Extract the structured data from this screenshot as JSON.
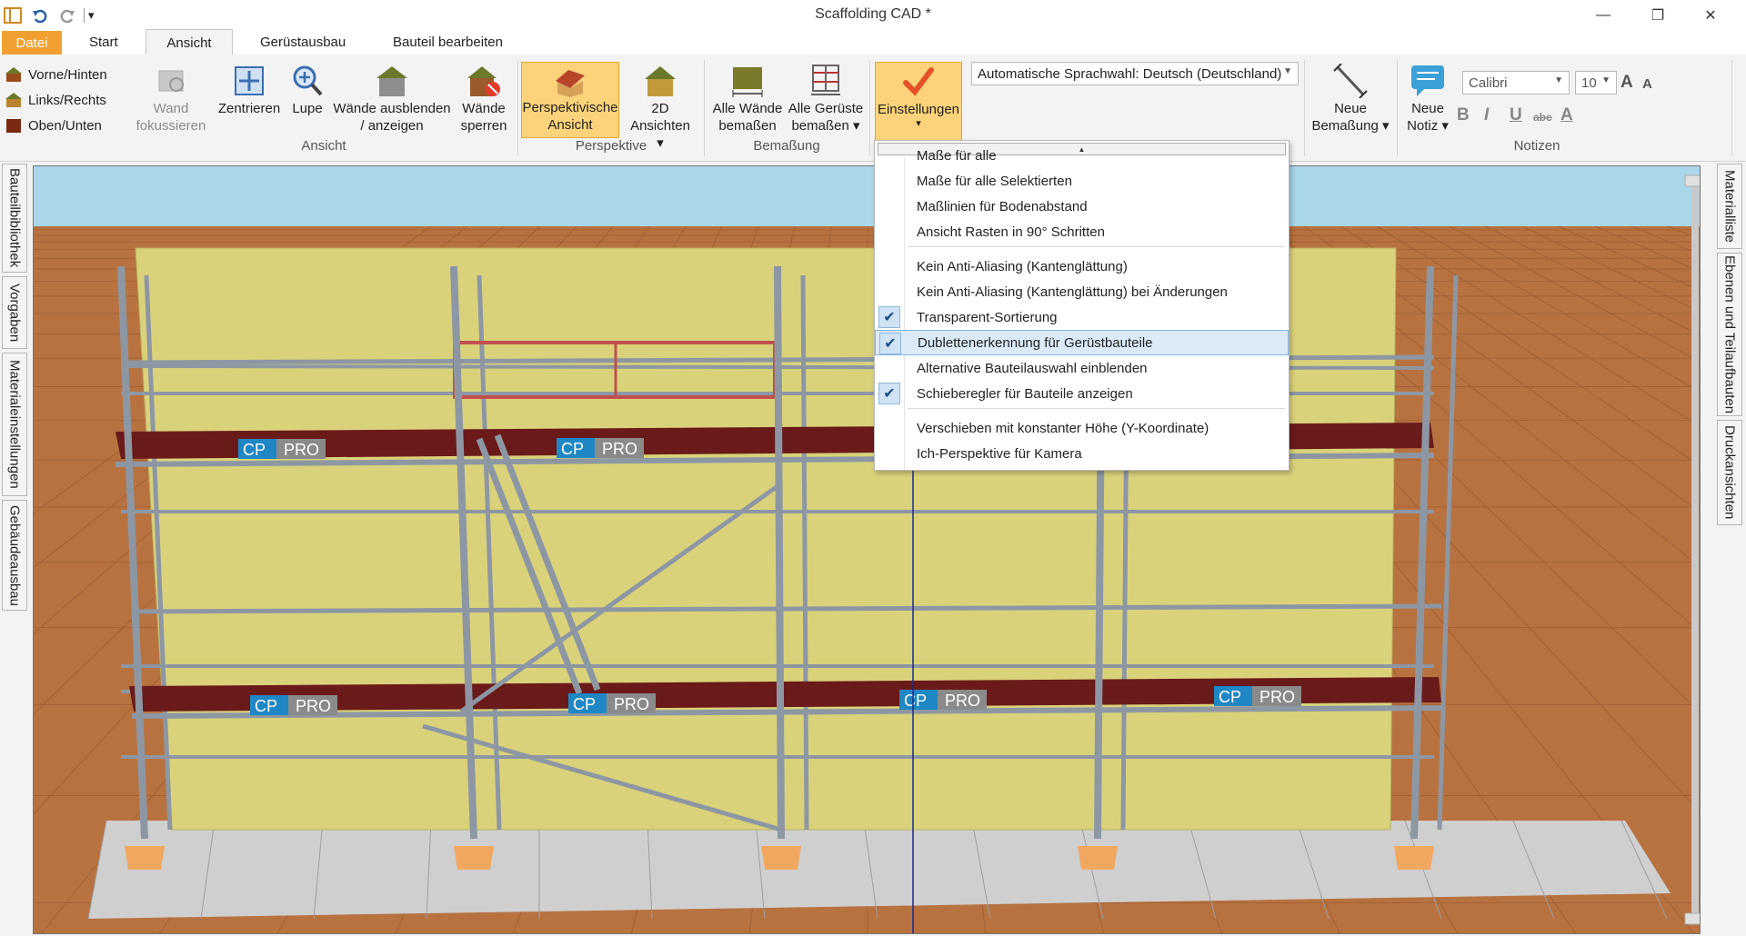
{
  "window": {
    "title": "Scaffolding CAD *",
    "minimize_glyph": "—",
    "maximize_glyph": "❐",
    "close_glyph": "✕"
  },
  "quick_access": {
    "undo_icon": "undo-icon",
    "redo_icon": "redo-icon",
    "customize_glyph": "▾"
  },
  "tabs": [
    {
      "label": "Datei",
      "state": "file"
    },
    {
      "label": "Start",
      "state": "normal"
    },
    {
      "label": "Ansicht",
      "state": "active"
    },
    {
      "label": "Gerüstausbau",
      "state": "normal"
    },
    {
      "label": "Bauteil bearbeiten",
      "state": "normal"
    }
  ],
  "ribbon": {
    "ansicht_group": {
      "label": "Ansicht",
      "small_buttons": [
        "Vorne/Hinten",
        "Links/Rechts",
        "Oben/Unten"
      ],
      "wand_fokussieren": [
        "Wand",
        "fokussieren"
      ],
      "zentrieren": "Zentrieren",
      "lupe": "Lupe",
      "waende_ausblenden": [
        "Wände ausblenden",
        "/ anzeigen"
      ],
      "waende_sperren": [
        "Wände",
        "sperren"
      ]
    },
    "perspektive_group": {
      "label": "Perspektive",
      "perspektivische_ansicht": [
        "Perspektivische",
        "Ansicht"
      ],
      "ansichten_2d": [
        "2D",
        "Ansichten ▾"
      ]
    },
    "bemassung_group": {
      "label": "Bemaßung",
      "alle_waende": [
        "Alle Wände",
        "bemaßen"
      ],
      "alle_gerueste": [
        "Alle Gerüste",
        "bemaßen ▾"
      ]
    },
    "einstellungen": {
      "label": "Einstellungen",
      "arrow": "▾"
    },
    "language_combo": "Automatische Sprachwahl: Deutsch (Deutschland)",
    "neue_bemassung": [
      "Neue",
      "Bemaßung ▾"
    ],
    "notizen_group": {
      "label": "Notizen",
      "neue_notiz": [
        "Neue",
        "Notiz ▾"
      ],
      "font": "Calibri",
      "size": "10",
      "bold": "B",
      "italic": "I",
      "underline": "U",
      "strike": "abc",
      "font_color": "A",
      "grow_font": "A",
      "shrink_font": "A"
    }
  },
  "left_side_tabs": [
    "Bauteilbibliothek",
    "Vorgaben",
    "Materialeinstellungen",
    "Gebäudeausbau"
  ],
  "right_side_tabs": [
    "Materialliste",
    "Ebenen und Teilaufbauten",
    "Druckansichten"
  ],
  "dropdown": {
    "scroll_up_glyph": "▲",
    "items": [
      {
        "label": "Maße für alle",
        "checked": false
      },
      {
        "label": "Maße für alle Selektierten",
        "checked": false
      },
      {
        "label": "Maßlinien für Bodenabstand",
        "checked": false
      },
      {
        "label": "Ansicht Rasten in 90° Schritten",
        "checked": false
      },
      {
        "label": "Kein Anti-Aliasing (Kantenglättung)",
        "checked": false
      },
      {
        "label": "Kein Anti-Aliasing (Kantenglättung) bei Änderungen",
        "checked": false
      },
      {
        "label": "Transparent-Sortierung",
        "checked": true
      },
      {
        "label": "Dublettenerkennung für Gerüstbauteile",
        "checked": true,
        "highlighted": true
      },
      {
        "label": "Alternative Bauteilauswahl einblenden",
        "checked": false
      },
      {
        "label": "Schieberegler für Bauteile anzeigen",
        "checked": true
      },
      {
        "label": "Verschieben mit konstanter Höhe (Y-Koordinate)",
        "checked": false
      },
      {
        "label": "Ich-Perspektive für Kamera",
        "checked": false
      }
    ],
    "check_glyph": "✔"
  },
  "scene": {
    "brand_left": "CP",
    "brand_right": "PRO",
    "colors": {
      "sky": "#a9d6ea",
      "ground": "#b87240",
      "wall": "#d9d27a",
      "deck": "#6b1a1a",
      "pipe": "#8d97a3",
      "foot": "#f0a860",
      "floor": "#cfcfcf"
    }
  }
}
